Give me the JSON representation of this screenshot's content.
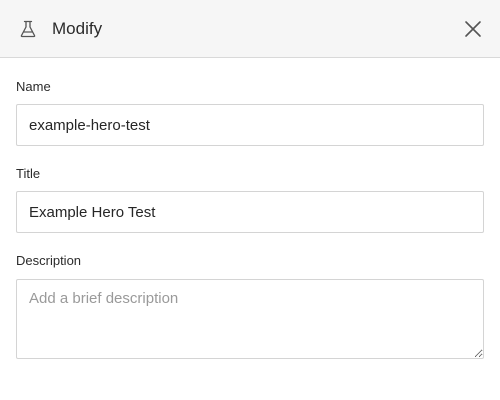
{
  "dialog": {
    "title": "Modify",
    "icons": {
      "header": "flask-icon",
      "close": "close-icon"
    }
  },
  "form": {
    "name": {
      "label": "Name",
      "value": "example-hero-test"
    },
    "title": {
      "label": "Title",
      "value": "Example Hero Test"
    },
    "description": {
      "label": "Description",
      "value": "",
      "placeholder": "Add a brief description"
    }
  }
}
